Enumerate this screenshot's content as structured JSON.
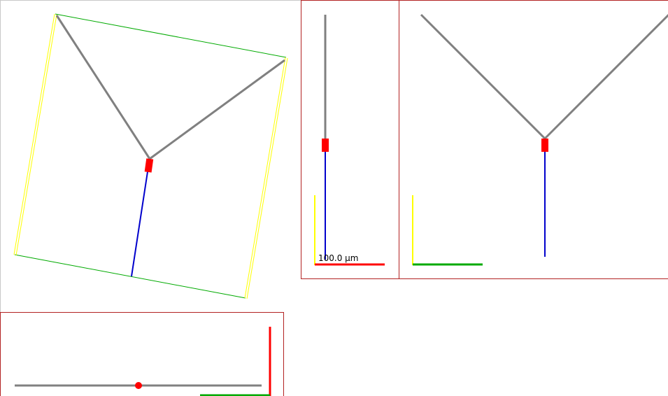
{
  "colors": {
    "background": "#ffffff",
    "viewport_border": "#b22222",
    "dendrite": "#808080",
    "soma": "#ff0000",
    "axon": "#0000cc",
    "bbox_x_edge": "#00aa00",
    "bbox_y_edge": "#ffff00",
    "axis_x": "#00aa00",
    "axis_y": "#ffff00",
    "axis_z": "#ff0000"
  },
  "scale_bar": {
    "label": "100.0 µm"
  },
  "viewports": [
    {
      "name": "perspective-3d-view"
    },
    {
      "name": "side-view"
    },
    {
      "name": "front-view"
    },
    {
      "name": "top-view"
    }
  ]
}
